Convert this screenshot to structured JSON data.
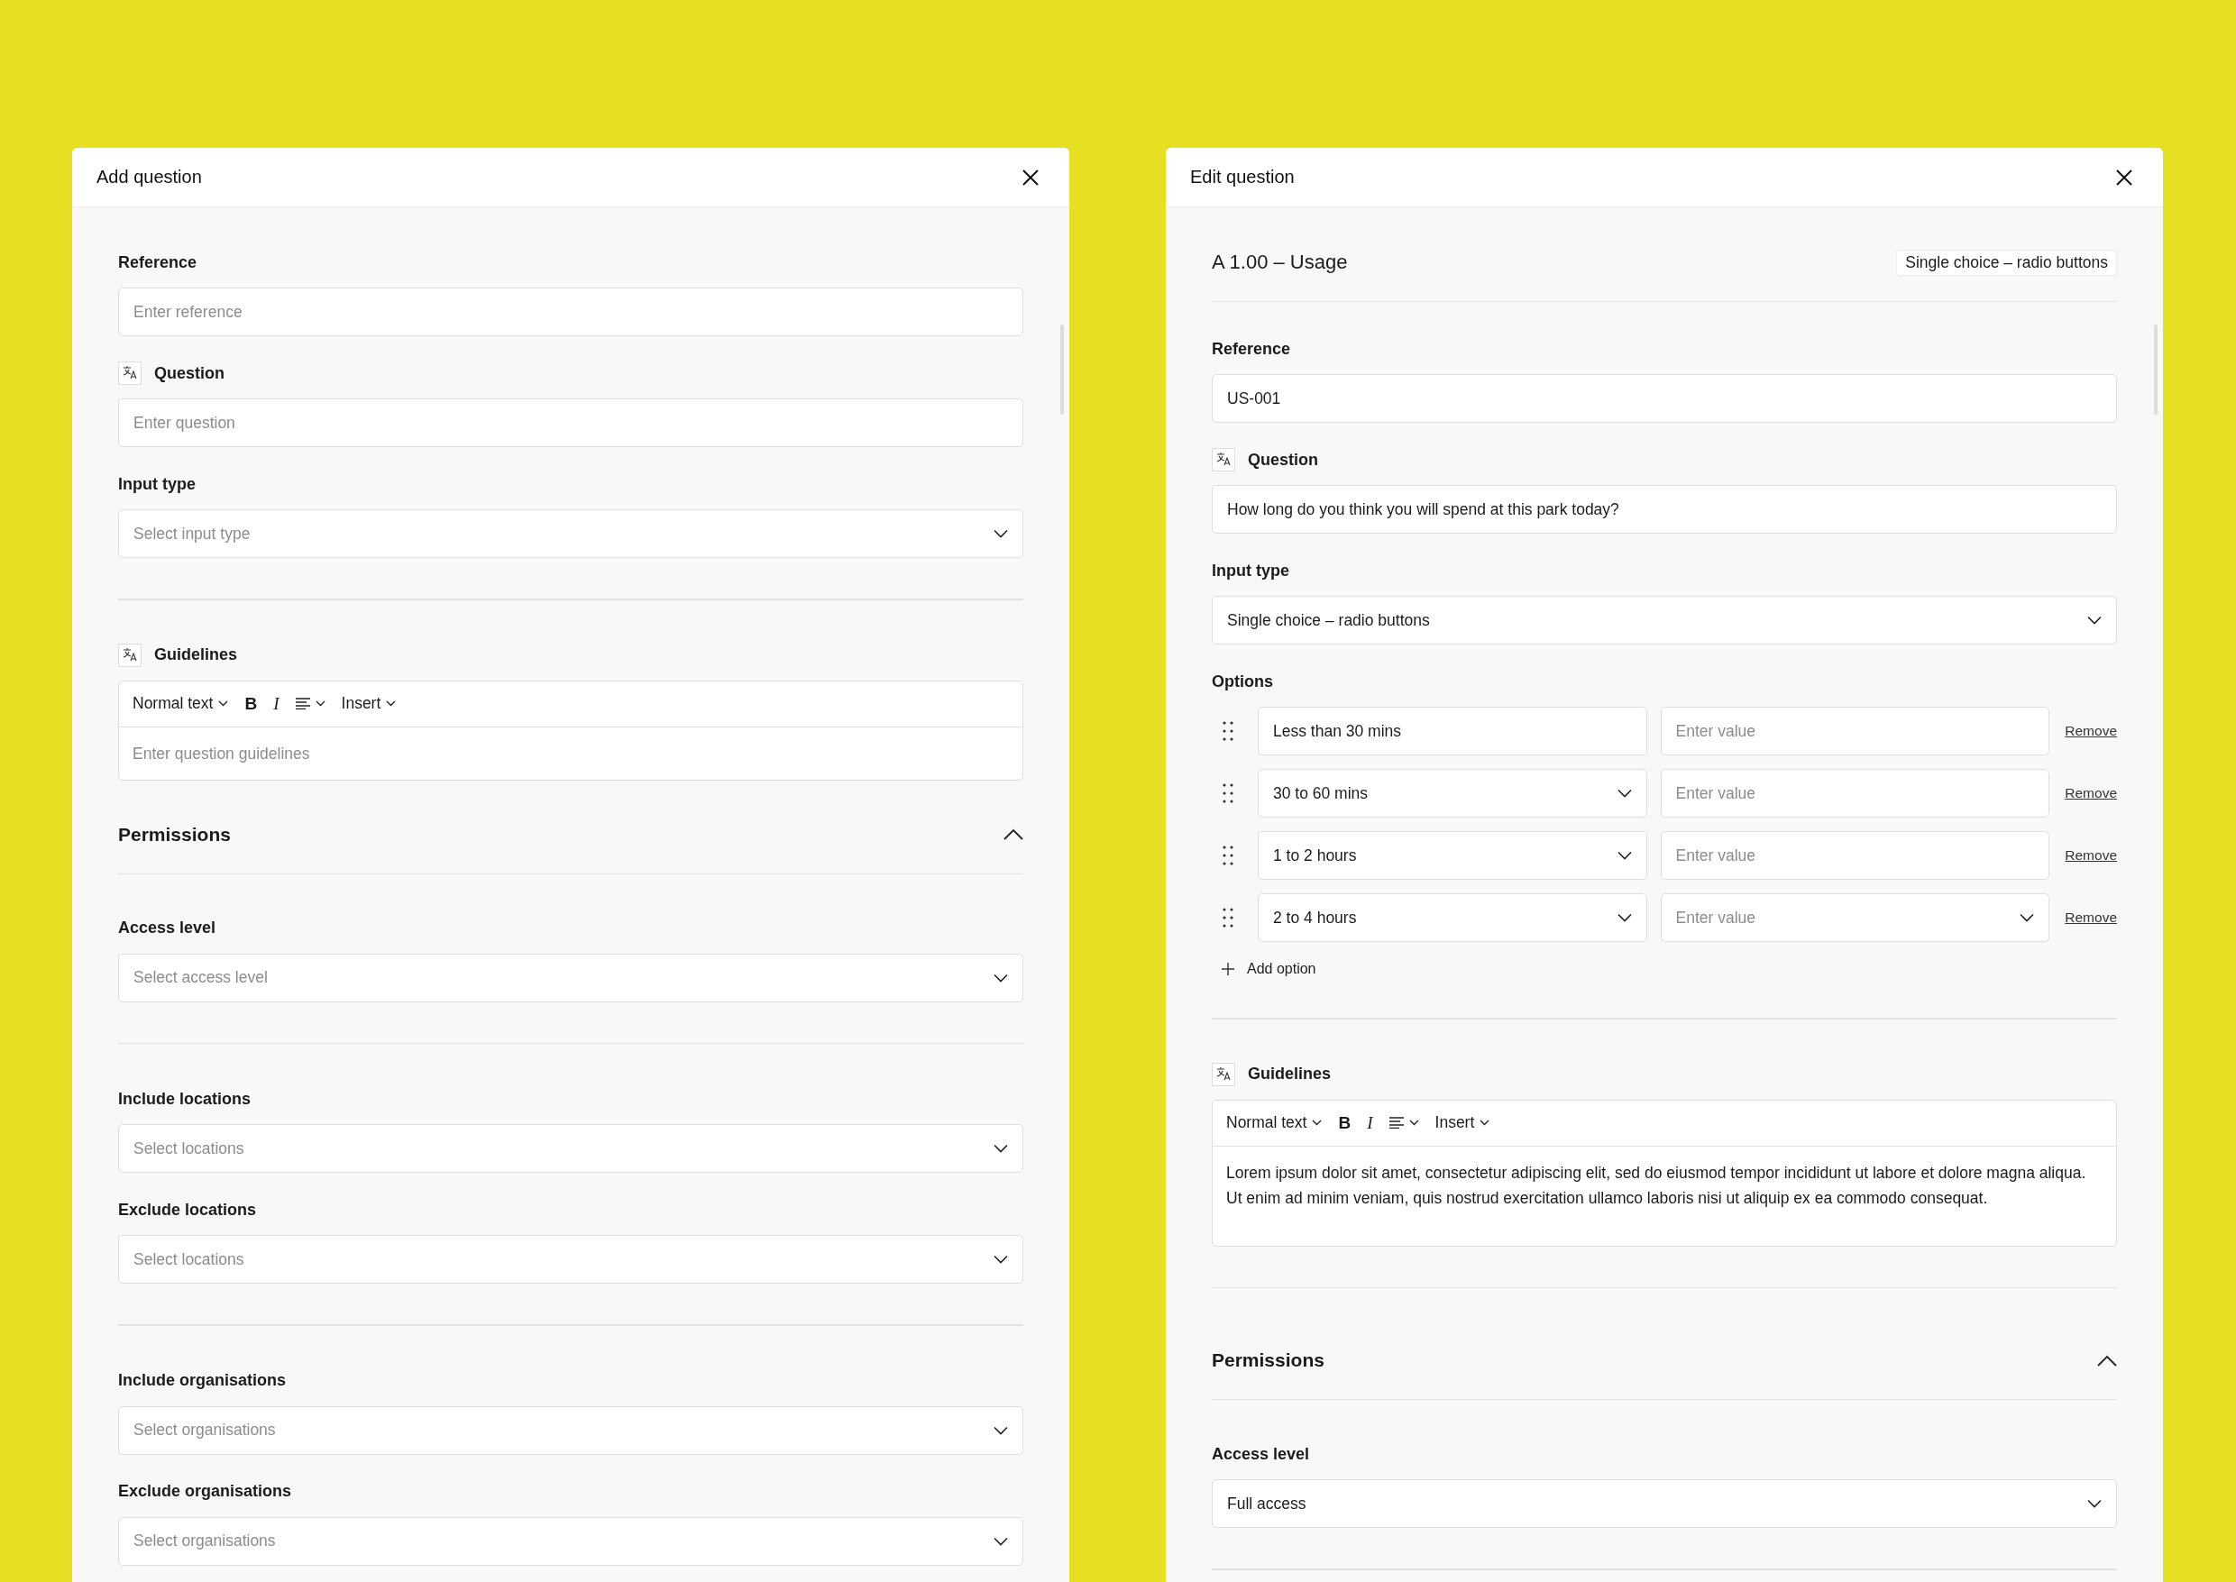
{
  "panels": [
    {
      "title": "Add question",
      "items": [
        {
          "kind": "text",
          "label": "Reference",
          "translatable": false,
          "placeholder": "Enter reference"
        },
        {
          "kind": "text",
          "label": "Question",
          "translatable": true,
          "placeholder": "Enter question"
        },
        {
          "kind": "select",
          "label": "Input type",
          "translatable": false,
          "placeholder": "Select input type"
        },
        {
          "kind": "divider"
        },
        {
          "kind": "editor",
          "label": "Guidelines",
          "translatable": true,
          "toolbar": {
            "style": "Normal text",
            "bold": "B",
            "italic": "I",
            "insert": "Insert"
          },
          "placeholder": "Enter question guidelines"
        },
        {
          "kind": "section",
          "title": "Permissions",
          "expanded": true
        },
        {
          "kind": "select",
          "label": "Access level",
          "translatable": false,
          "placeholder": "Select access level"
        },
        {
          "kind": "divider"
        },
        {
          "kind": "select",
          "label": "Include locations",
          "translatable": false,
          "placeholder": "Select locations"
        },
        {
          "kind": "select",
          "label": "Exclude locations",
          "translatable": false,
          "placeholder": "Select locations"
        },
        {
          "kind": "divider"
        },
        {
          "kind": "select",
          "label": "Include organisations",
          "translatable": false,
          "placeholder": "Select organisations"
        },
        {
          "kind": "select",
          "label": "Exclude organisations",
          "translatable": false,
          "placeholder": "Select organisations"
        }
      ]
    },
    {
      "title": "Edit question",
      "items": [
        {
          "kind": "heading",
          "title": "A 1.00 – Usage",
          "badge": "Single choice – radio buttons"
        },
        {
          "kind": "text",
          "label": "Reference",
          "translatable": false,
          "value": "US-001"
        },
        {
          "kind": "text",
          "label": "Question",
          "translatable": true,
          "value": "How long do you think you will spend at this park today?"
        },
        {
          "kind": "select",
          "label": "Input type",
          "translatable": false,
          "value": "Single choice – radio buttons"
        },
        {
          "kind": "options",
          "label": "Options",
          "rows": [
            {
              "label": "Less than 30 mins",
              "dropdown": false,
              "placeholder": "Enter value",
              "value_dropdown": false,
              "action": "Remove"
            },
            {
              "label": "30 to 60 mins",
              "dropdown": true,
              "placeholder": "Enter value",
              "value_dropdown": false,
              "action": "Remove"
            },
            {
              "label": "1 to 2 hours",
              "dropdown": true,
              "placeholder": "Enter value",
              "value_dropdown": false,
              "action": "Remove"
            },
            {
              "label": "2 to 4 hours",
              "dropdown": true,
              "placeholder": "Enter value",
              "value_dropdown": true,
              "action": "Remove"
            }
          ],
          "add": "Add option"
        },
        {
          "kind": "divider"
        },
        {
          "kind": "editor",
          "label": "Guidelines",
          "translatable": true,
          "toolbar": {
            "style": "Normal text",
            "bold": "B",
            "italic": "I",
            "insert": "Insert"
          },
          "value": "Lorem ipsum dolor sit amet, consectetur adipiscing elit, sed do eiusmod tempor incididunt ut labore et dolore magna aliqua. Ut enim ad minim veniam, quis nostrud exercitation ullamco laboris nisi ut aliquip ex ea commodo consequat."
        },
        {
          "kind": "divider"
        },
        {
          "kind": "section",
          "title": "Permissions",
          "expanded": true
        },
        {
          "kind": "select",
          "label": "Access level",
          "translatable": false,
          "value": "Full access"
        },
        {
          "kind": "divider"
        }
      ]
    }
  ]
}
